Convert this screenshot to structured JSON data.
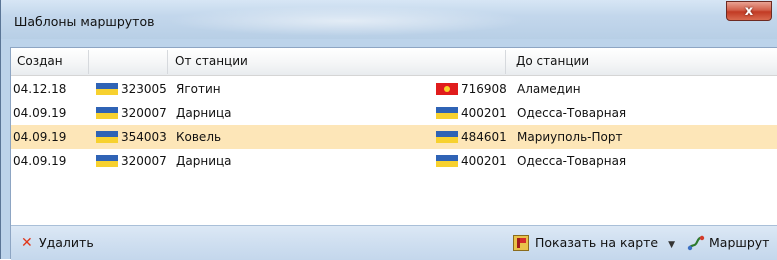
{
  "window": {
    "title": "Шаблоны маршрутов",
    "close_glyph": "x"
  },
  "columns": {
    "created": "Создан",
    "from": "От станции",
    "to": "До станции"
  },
  "rows": [
    {
      "date": "04.12.18",
      "from_flag": "flag-ukraine",
      "from_code": "323005",
      "from_name": "Яготин",
      "to_flag": "flag-kyrgyzstan",
      "to_code": "716908",
      "to_name": "Аламедин"
    },
    {
      "date": "04.09.19",
      "from_flag": "flag-ukraine",
      "from_code": "320007",
      "from_name": "Дарница",
      "to_flag": "flag-ukraine",
      "to_code": "400201",
      "to_name": "Одесса-Товарная"
    },
    {
      "date": "04.09.19",
      "from_flag": "flag-ukraine",
      "from_code": "354003",
      "from_name": "Ковель",
      "to_flag": "flag-ukraine",
      "to_code": "484601",
      "to_name": "Мариуполь-Порт"
    },
    {
      "date": "04.09.19",
      "from_flag": "flag-ukraine",
      "from_code": "320007",
      "from_name": "Дарница",
      "to_flag": "flag-ukraine",
      "to_code": "400201",
      "to_name": "Одесса-Товарная"
    }
  ],
  "selected_row": 2,
  "toolbar": {
    "delete_label": "Удалить",
    "show_map_label": "Показать на карте",
    "route_label": "Маршрут"
  },
  "colors": {
    "selection": "#fde6b8",
    "ua_blue": "#2f63b5",
    "ua_yellow": "#f7d12f",
    "kg_red": "#e01c1c",
    "delete_icon": "#e0361a"
  }
}
